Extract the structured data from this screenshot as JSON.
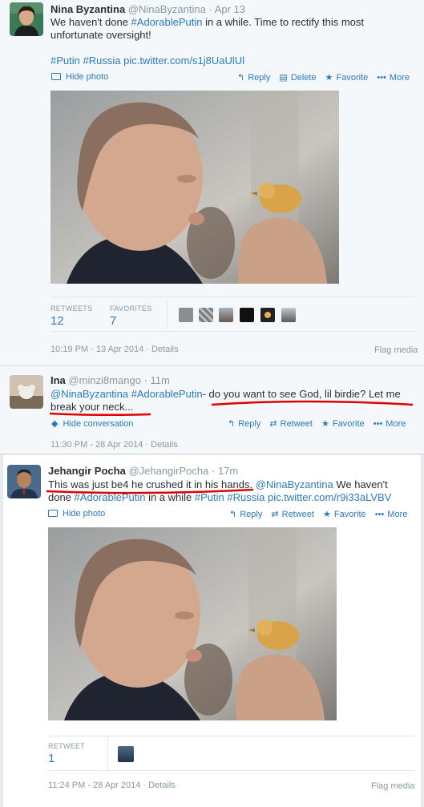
{
  "tweet1": {
    "name": "Nina Byzantina",
    "handle": "@NinaByzantina",
    "sep": " · ",
    "date": "Apr 13",
    "text_part1": "We haven't done ",
    "hashtag1": "#AdorablePutin",
    "text_part2": " in a while. Time to rectify this most",
    "text_line2": "unfortunate oversight!",
    "hashtag2": "#Putin",
    "hashtag3": "#Russia",
    "link": "pic.twitter.com/s1j8UaUlUl",
    "toggle_label": "Hide photo",
    "actions": {
      "reply": "Reply",
      "delete": "Delete",
      "favorite": "Favorite",
      "more": "More"
    },
    "stats": {
      "retweets_label": "RETWEETS",
      "retweets": "12",
      "favorites_label": "FAVORITES",
      "favorites": "7"
    },
    "timestamp": "10:19 PM - 13 Apr 2014 · Details",
    "flag": "Flag media"
  },
  "reply": {
    "name": "Ina",
    "handle": "@minzi8mango",
    "sep": " · ",
    "date": "11m",
    "mention": "@NinaByzantina",
    "hashtag": "#AdorablePutin",
    "text_rest": "- do you want to see God, lil birdie? Let me",
    "text_line2": "break your neck...",
    "toggle_label": "Hide conversation",
    "actions": {
      "reply": "Reply",
      "retweet": "Retweet",
      "favorite": "Favorite",
      "more": "More"
    },
    "timestamp": "11:30 PM - 28 Apr 2014 · Details"
  },
  "tweet3": {
    "name": "Jehangir Pocha",
    "handle": "@JehangirPocha",
    "sep": " · ",
    "date": "17m",
    "text_part1": "This was just be4 he crushed it in his hands. ",
    "mention": "@NinaByzantina",
    "text_part2": " We haven't",
    "text_line2_a": "done ",
    "hashtag1": "#AdorablePutin",
    "text_line2_b": " in a while ",
    "hashtag2": "#Putin",
    "hashtag3": "#Russia",
    "link": "pic.twitter.com/r9i33aLVBV",
    "toggle_label": "Hide photo",
    "actions": {
      "reply": "Reply",
      "retweet": "Retweet",
      "favorite": "Favorite",
      "more": "More"
    },
    "stats": {
      "retweet_label": "RETWEET",
      "retweets": "1"
    },
    "timestamp": "11:24 PM - 28 Apr 2014 · Details",
    "flag": "Flag media"
  },
  "icons": [
    "reply-icon",
    "delete-icon",
    "favorite-icon",
    "more-icon",
    "retweet-icon",
    "photo-icon",
    "conversation-icon"
  ],
  "colors": {
    "link": "#2b7bb9",
    "muted": "#8899a6",
    "text": "#292f33",
    "annotation": "#e00000"
  }
}
